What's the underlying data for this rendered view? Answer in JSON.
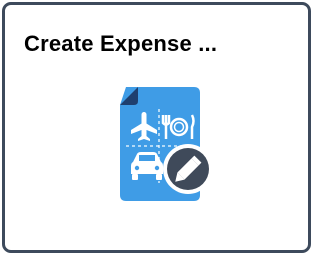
{
  "tile": {
    "title": "Create Expense ...",
    "icon": "expense-report-edit-icon",
    "colors": {
      "border": "#3d4a5c",
      "document": "#3f9ce6",
      "document_fold": "#1f3f6e",
      "glyphs": "#ffffff",
      "pencil_badge": "#3f4a5a"
    }
  }
}
